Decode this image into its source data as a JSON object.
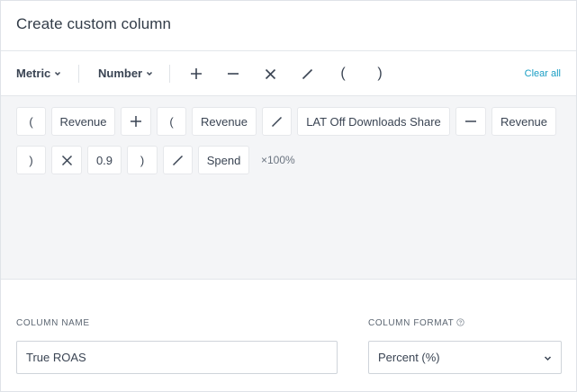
{
  "dialog": {
    "title": "Create custom column"
  },
  "toolbar": {
    "metric_label": "Metric",
    "number_label": "Number",
    "operators": [
      {
        "name": "plus",
        "icon": "plus-icon"
      },
      {
        "name": "minus",
        "icon": "minus-icon"
      },
      {
        "name": "multiply",
        "icon": "multiply-icon"
      },
      {
        "name": "divide",
        "icon": "divide-icon"
      },
      {
        "name": "open-paren",
        "glyph": "("
      },
      {
        "name": "close-paren",
        "glyph": ")"
      }
    ],
    "clear_all_label": "Clear all"
  },
  "formula": {
    "tokens": [
      {
        "kind": "paren",
        "text": "("
      },
      {
        "kind": "metric",
        "text": "Revenue"
      },
      {
        "kind": "operator",
        "icon": "plus-icon"
      },
      {
        "kind": "paren",
        "text": "("
      },
      {
        "kind": "metric",
        "text": "Revenue"
      },
      {
        "kind": "operator",
        "icon": "divide-icon"
      },
      {
        "kind": "metric",
        "text": "LAT Off Downloads Share"
      },
      {
        "kind": "operator",
        "icon": "minus-icon"
      },
      {
        "kind": "metric",
        "text": "Revenue"
      },
      {
        "kind": "paren",
        "text": ")"
      },
      {
        "kind": "operator",
        "icon": "multiply-icon"
      },
      {
        "kind": "number",
        "text": "0.9"
      },
      {
        "kind": "paren",
        "text": ")"
      },
      {
        "kind": "operator",
        "icon": "divide-icon"
      },
      {
        "kind": "metric",
        "text": "Spend"
      }
    ],
    "suffix": "×100%"
  },
  "column_name": {
    "label": "Column name",
    "value": "True ROAS"
  },
  "column_format": {
    "label": "Column format",
    "value": "Percent (%)",
    "help_icon": "help-circle-icon"
  },
  "colors": {
    "accent": "#1a9ec4",
    "canvas_bg": "#f4f5f7",
    "text": "#3a4453"
  }
}
